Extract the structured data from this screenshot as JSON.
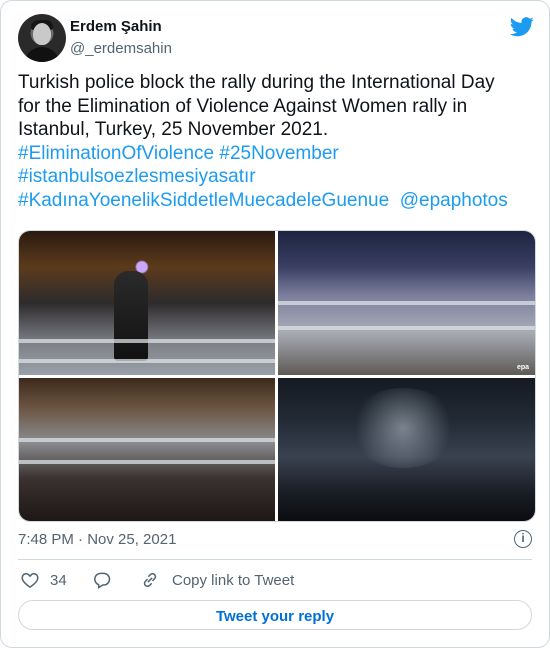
{
  "author": {
    "name": "Erdem Şahin",
    "handle": "@_erdemsahin"
  },
  "tweet": {
    "lines": [
      "Turkish police block the rally during the International Day",
      "for the Elimination of Violence Against Women rally in",
      "Istanbul, Turkey, 25 November 2021."
    ],
    "hashtags_line1": "#EliminationOfViolence #25November",
    "hashtags_line2": "#istanbulsoezlesmesiyasatır",
    "hashtags_line3a": "#KadınaYoenelikSiddetleMuecadeleGuenue",
    "mention": "@epaphotos"
  },
  "media": {
    "watermark": "epa"
  },
  "meta": {
    "timestamp": "7:48 PM · Nov 25, 2021"
  },
  "actions": {
    "like_count": "34",
    "copy_link_label": "Copy link to Tweet",
    "reply_button_label": "Tweet your reply"
  },
  "colors": {
    "accent": "#1d9bf0",
    "text": "#0f1419",
    "muted": "#536471",
    "border": "#cfd9de"
  },
  "icons": [
    "twitter-bird-icon",
    "info-icon",
    "heart-icon",
    "reply-icon",
    "link-icon"
  ]
}
